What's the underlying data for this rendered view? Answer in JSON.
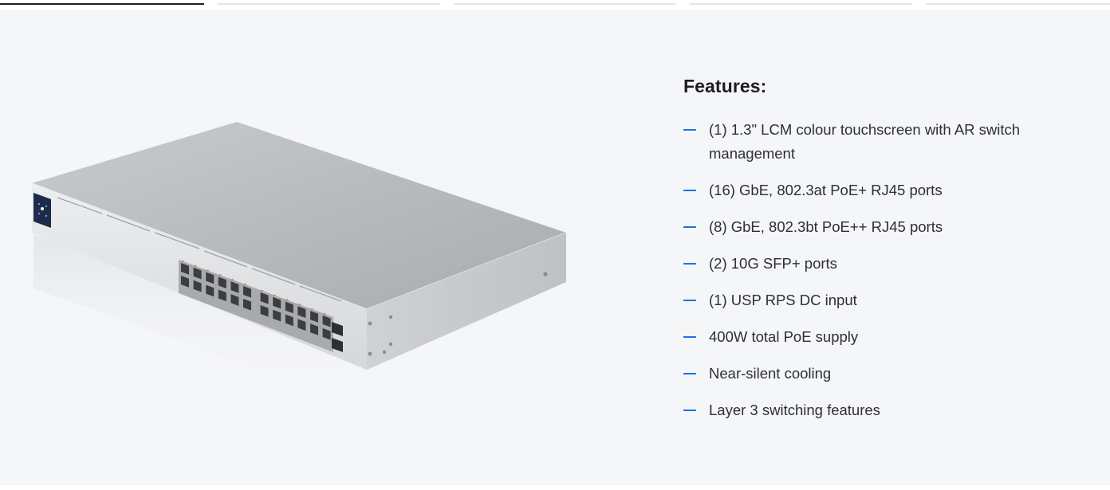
{
  "tabs": [
    {
      "active": true
    },
    {
      "active": false
    },
    {
      "active": false
    },
    {
      "active": false
    },
    {
      "active": false
    }
  ],
  "features": {
    "heading": "Features:",
    "items": [
      "(1) 1.3\" LCM colour touchscreen with AR switch management",
      "(16) GbE, 802.3at PoE+ RJ45 ports",
      "(8) GbE, 802.3bt PoE++ RJ45 ports",
      "(2) 10G SFP+ ports",
      "(1) USP RPS DC input",
      "400W total PoE supply",
      "Near-silent cooling",
      "Layer 3 switching features"
    ]
  },
  "colors": {
    "accent": "#1c73e8",
    "panel_background": "#f5f6f8",
    "heading_text": "#1c1d21",
    "body_text": "#2d2f33"
  }
}
